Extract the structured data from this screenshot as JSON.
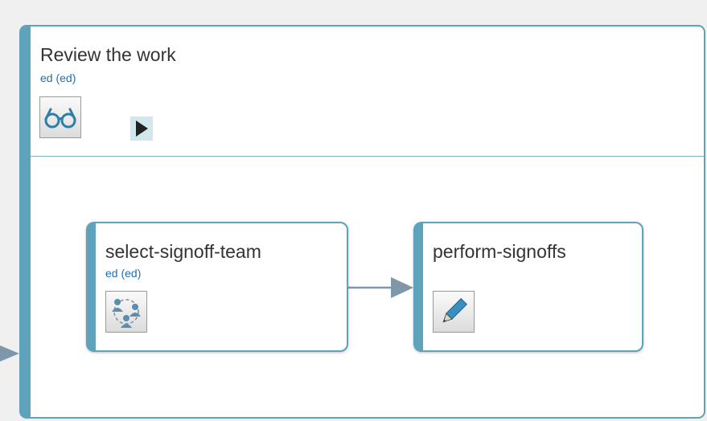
{
  "container": {
    "title": "Review the work",
    "owner": "ed (ed)",
    "icon": "glasses-icon",
    "play_icon": "play-icon"
  },
  "tasks": [
    {
      "name": "select-signoff-team",
      "owner": "ed (ed)",
      "icon": "team-icon"
    },
    {
      "name": "perform-signoffs",
      "owner": "",
      "icon": "pencil-icon"
    }
  ],
  "colors": {
    "accent": "#5ea2bb",
    "owner_text": "#1f6fb0",
    "arrow": "#7f98a9"
  }
}
